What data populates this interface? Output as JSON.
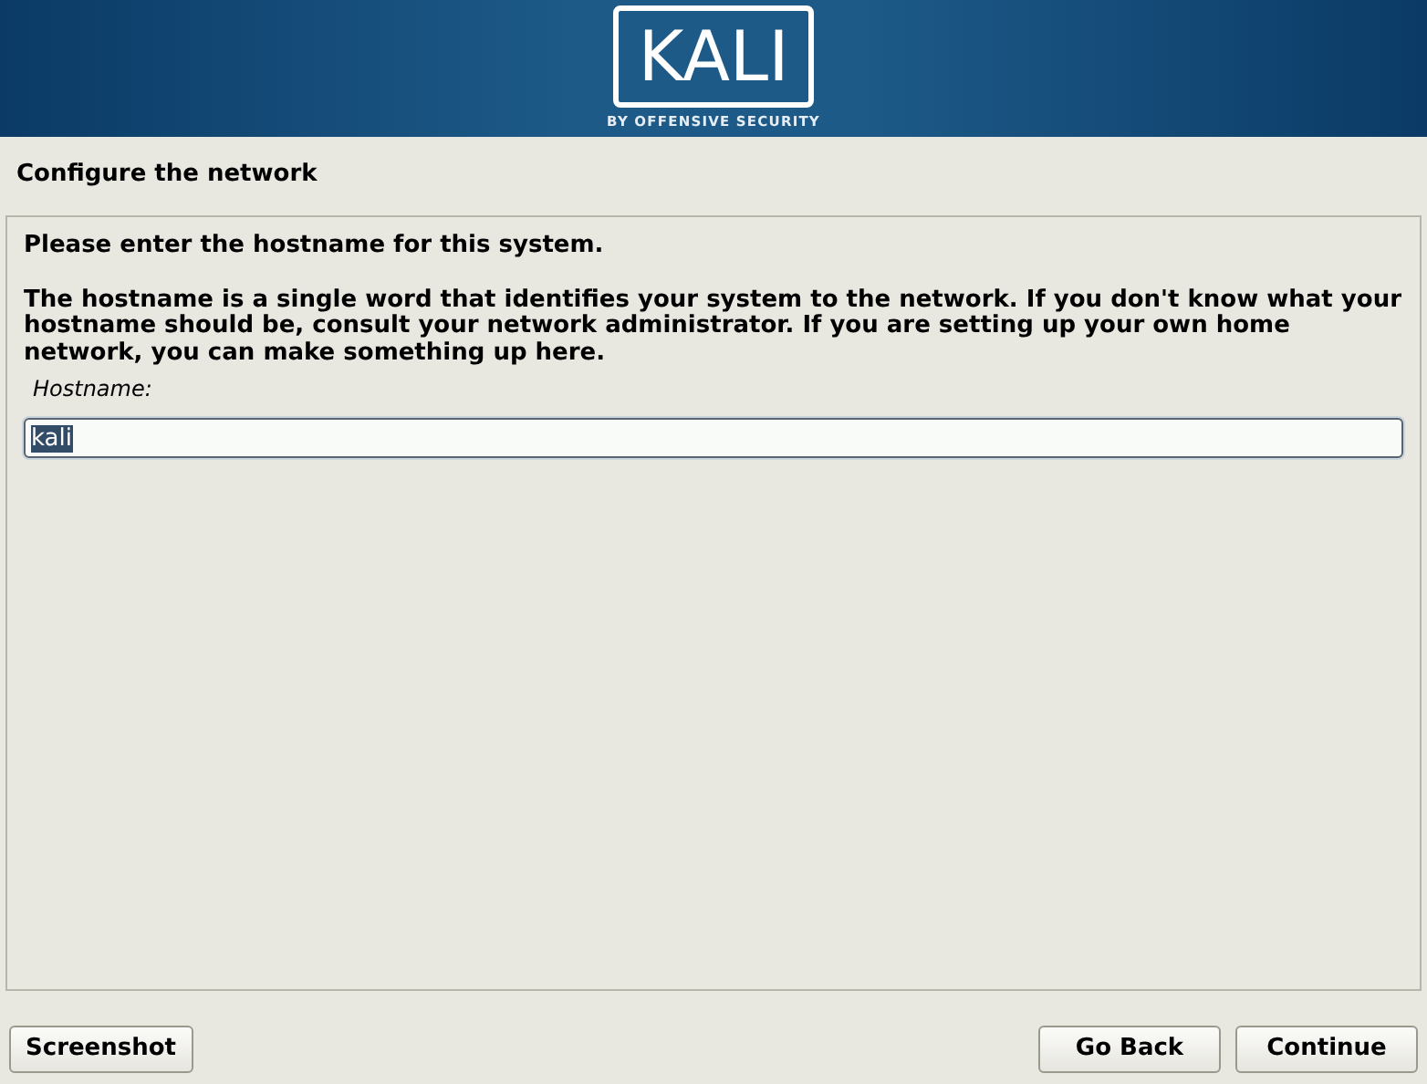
{
  "banner": {
    "logo_text": "KALI",
    "tagline": "BY OFFENSIVE SECURITY"
  },
  "title": "Configure the network",
  "prompt": "Please enter the hostname for this system.",
  "description": "The hostname is a single word that identifies your system to the network. If you don't know what your hostname should be, consult your network administrator. If you are setting up your own home network, you can make something up here.",
  "field": {
    "label": "Hostname:",
    "value": "kali",
    "text_selected": true
  },
  "buttons": [
    {
      "label": "Screenshot",
      "kind": "left"
    },
    {
      "label": "Go Back",
      "kind": "right"
    },
    {
      "label": "Continue",
      "kind": "right"
    }
  ]
}
